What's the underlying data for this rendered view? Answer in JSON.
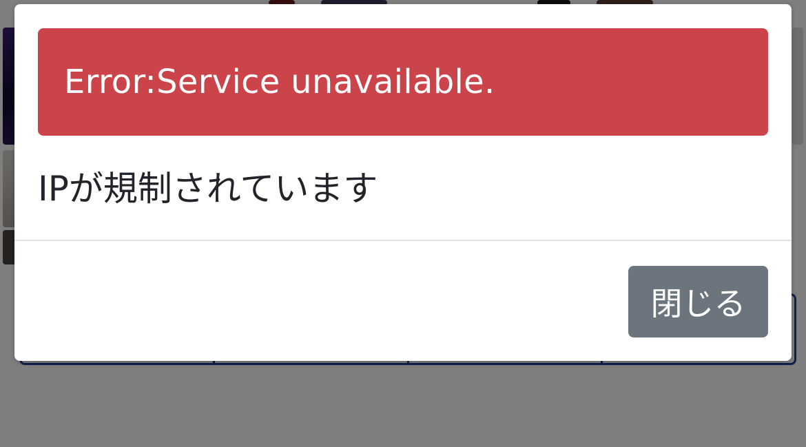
{
  "modal": {
    "alert": {
      "text": "Error:Service unavailable.",
      "color": "#cb444a"
    },
    "body_text": "IPが規制されています",
    "footer": {
      "close_label": "閉じる",
      "close_color": "#6c757d"
    }
  },
  "backdrop_color": "#000000",
  "background_accent_color": "#1d3f9a"
}
